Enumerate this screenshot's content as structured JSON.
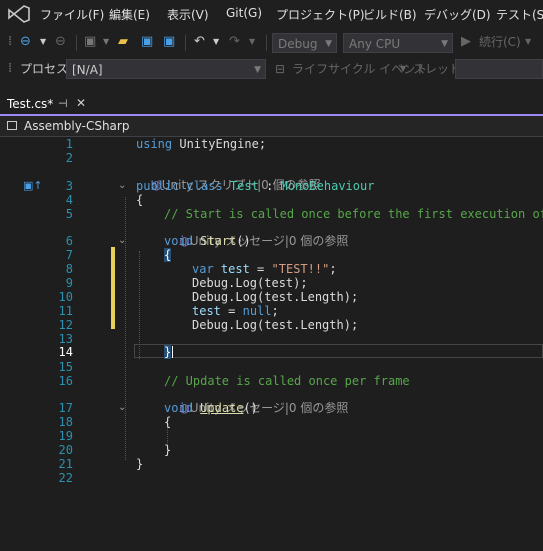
{
  "menu": [
    "ファイル(F)",
    "編集(E)",
    "表示(V)",
    "Git(G)",
    "プロジェクト(P)",
    "ビルド(B)",
    "デバッグ(D)",
    "テスト(S)"
  ],
  "toolbar": {
    "config": "Debug",
    "platform": "Any CPU",
    "continue": "続行(C)"
  },
  "process": {
    "label": "プロセス:",
    "value": "[N/A]",
    "lifecycle": "ライフサイクル イベント",
    "thread": "スレッド:"
  },
  "tab": {
    "title": "Test.cs*"
  },
  "navbar": {
    "project": "Assembly-CSharp"
  },
  "codelens": {
    "class_refs": "Unity スクリプト|0 個の参照",
    "start_refs": "Unity メッセージ|0 個の参照",
    "update_refs": "Unity メッセージ|0 個の参照"
  },
  "code": {
    "l1_kw": "using",
    "l1_rest": " UnityEngine;",
    "l3_kw": "public class",
    "l3_type": "Test",
    "l3_colon": " : ",
    "l3_base": "MonoBehaviour",
    "l4": "{",
    "l5": "// Start is called once before the first execution of",
    "l6_kw": "void",
    "l6_fn": "Start",
    "l6_rest": "()",
    "l7": "{",
    "l8_kw": "var",
    "l8_var": "test",
    "l8_eq": " = ",
    "l8_str": "\"TEST!!\"",
    "l8_end": ";",
    "l9": "Debug.Log(test);",
    "l10": "Debug.Log(test.Length);",
    "l11_var": "test",
    "l11_eq": " = ",
    "l11_kw": "null",
    "l11_end": ";",
    "l12": "Debug.Log(test.Length);",
    "l14": "}",
    "l16": "// Update is called once per frame",
    "l17_kw": "void",
    "l17_fn": "Update",
    "l17_rest": "()",
    "l18": "{",
    "l20": "}",
    "l21": "}"
  },
  "line_numbers": [
    "1",
    "2",
    "3",
    "4",
    "5",
    "6",
    "7",
    "8",
    "9",
    "10",
    "11",
    "12",
    "13",
    "14",
    "15",
    "16",
    "17",
    "18",
    "19",
    "20",
    "21",
    "22"
  ],
  "colors": {
    "accent": "#9f88f1",
    "keyword": "#569cd6",
    "type": "#4ec9b0",
    "string": "#d69d85",
    "comment": "#57a64a",
    "linenum": "#2b91af"
  }
}
